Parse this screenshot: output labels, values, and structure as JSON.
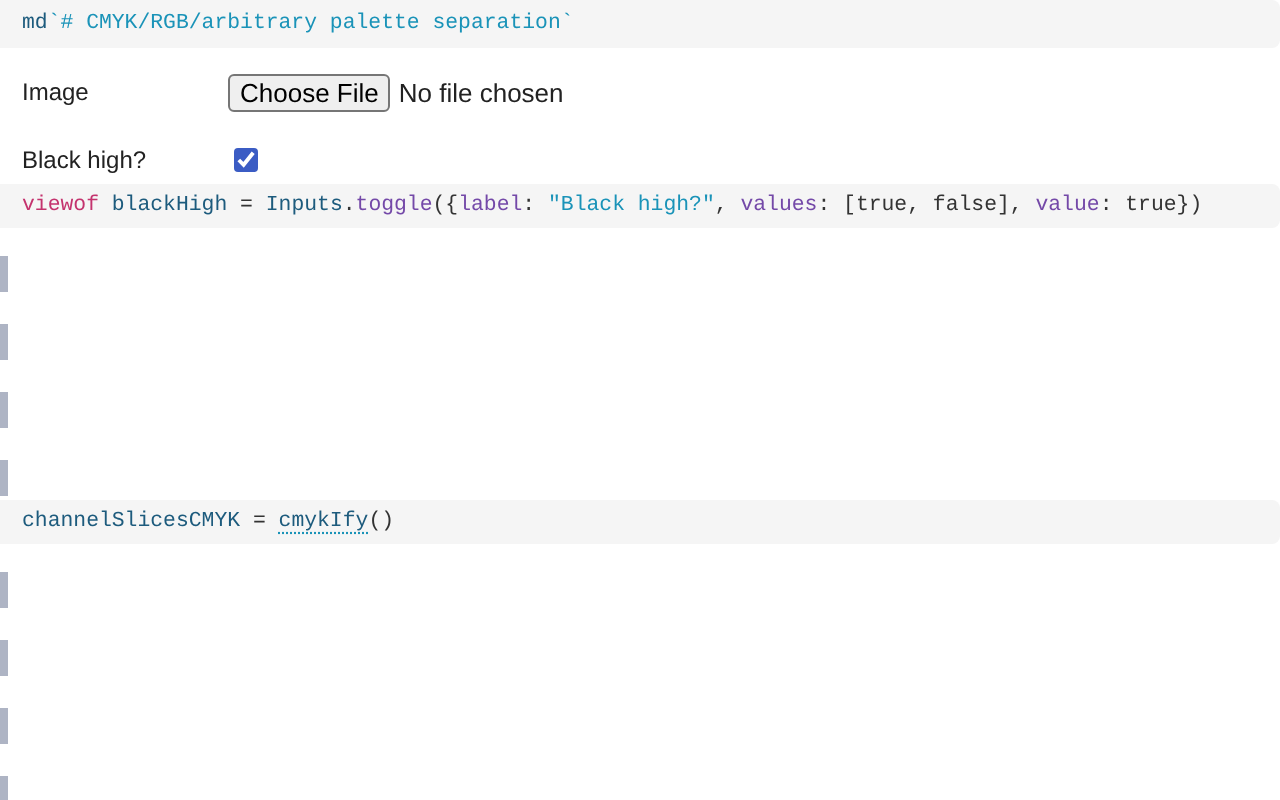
{
  "cells": [
    {
      "kind": "code",
      "tokens": [
        {
          "kind": "variable",
          "text": "md"
        },
        {
          "kind": "string",
          "text": "`# CMYK/RGB/arbitrary palette separation`"
        }
      ]
    },
    {
      "kind": "file",
      "label": "Image",
      "button": "Choose File",
      "status": "No file chosen"
    },
    {
      "kind": "checkbox",
      "label": "Black high?",
      "checked": true
    },
    {
      "kind": "code",
      "tokens": [
        {
          "kind": "keyword",
          "text": "viewof"
        },
        {
          "kind": "variable",
          "text": " blackHigh"
        },
        {
          "kind": "plain",
          "text": " = "
        },
        {
          "kind": "variable",
          "text": "Inputs"
        },
        {
          "kind": "plain",
          "text": "."
        },
        {
          "kind": "property",
          "text": "toggle"
        },
        {
          "kind": "plain",
          "text": "({"
        },
        {
          "kind": "property",
          "text": "label"
        },
        {
          "kind": "plain",
          "text": ": "
        },
        {
          "kind": "string",
          "text": "\"Black high?\""
        },
        {
          "kind": "plain",
          "text": ", "
        },
        {
          "kind": "property",
          "text": "values"
        },
        {
          "kind": "plain",
          "text": ": [true, false], "
        },
        {
          "kind": "property",
          "text": "value"
        },
        {
          "kind": "plain",
          "text": ": true})"
        }
      ]
    },
    {
      "kind": "pending"
    },
    {
      "kind": "pending"
    },
    {
      "kind": "pending"
    },
    {
      "kind": "pending"
    },
    {
      "kind": "code",
      "tokens": [
        {
          "kind": "variable",
          "text": "channelSlicesCMYK"
        },
        {
          "kind": "plain",
          "text": " = "
        },
        {
          "kind": "link",
          "text": "cmykIfy"
        },
        {
          "kind": "plain",
          "text": "()"
        }
      ]
    },
    {
      "kind": "pending"
    },
    {
      "kind": "pending"
    },
    {
      "kind": "pending"
    },
    {
      "kind": "pending"
    }
  ]
}
